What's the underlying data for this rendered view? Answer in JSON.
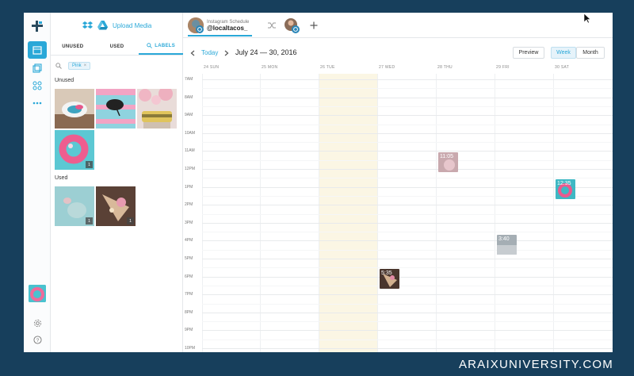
{
  "media_panel": {
    "upload_label": "Upload Media",
    "tabs": [
      "UNUSED",
      "USED",
      "LABELS"
    ],
    "active_tab": "LABELS",
    "filter_chip": "Pink",
    "sections": {
      "unused_title": "Unused",
      "used_title": "Used"
    },
    "unused_count_badge": "1",
    "used_counts": [
      "1",
      "1"
    ]
  },
  "header": {
    "account_subtitle": "Instagram Schedule",
    "account_name": "@localtacos_"
  },
  "toolbar": {
    "today": "Today",
    "date_range": "July 24 — 30, 2016",
    "preview": "Preview",
    "week": "Week",
    "month": "Month",
    "active_view": "Week"
  },
  "calendar": {
    "days": [
      "24 SUN",
      "25 MON",
      "26 TUE",
      "27 WED",
      "28 THU",
      "29 FRI",
      "30 SAT"
    ],
    "today_day": "26 TUE",
    "hours": [
      "7AM",
      "8AM",
      "9AM",
      "10AM",
      "11AM",
      "12PM",
      "1PM",
      "2PM",
      "3PM",
      "4PM",
      "5PM",
      "6PM",
      "7PM",
      "8PM",
      "9PM",
      "10PM"
    ],
    "events": [
      {
        "day": "28 THU",
        "time": "11:05"
      },
      {
        "day": "30 SAT",
        "time": "12:35"
      },
      {
        "day": "29 FRI",
        "time": "3:40"
      },
      {
        "day": "27 WED",
        "time": "5:35"
      }
    ]
  },
  "footer": {
    "brand": "ARAIXUNIVERSITY.COM"
  },
  "colors": {
    "accent": "#2aa8d8",
    "today_highlight": "#fbf6e4",
    "page_bg": "#173f5c"
  }
}
